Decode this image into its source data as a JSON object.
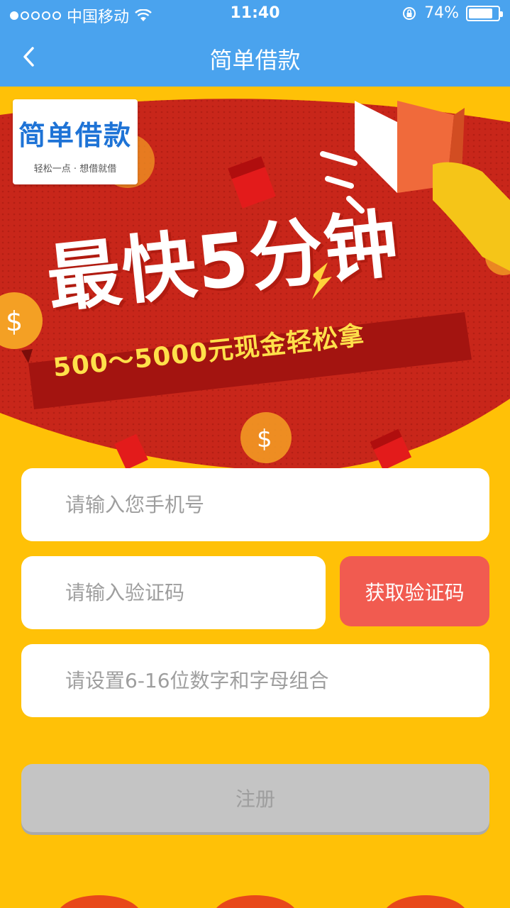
{
  "status_bar": {
    "carrier": "中国移动",
    "time": "11:40",
    "battery": "74%"
  },
  "nav": {
    "title": "简单借款"
  },
  "banner": {
    "logo_name": "简单借款",
    "logo_slogan": "轻松一点 · 想借就借",
    "headline": "最快5分钟",
    "subheadline": "500～5000元现金轻松拿"
  },
  "form": {
    "phone_placeholder": "请输入您手机号",
    "code_placeholder": "请输入验证码",
    "get_code_label": "获取验证码",
    "password_placeholder": "请设置6-16位数字和字母组合",
    "register_label": "注册"
  },
  "colors": {
    "top_bar": "#4AA3EE",
    "background": "#FFC107",
    "get_code_button": "#F15B50",
    "register_disabled": "#C4C4C4"
  }
}
